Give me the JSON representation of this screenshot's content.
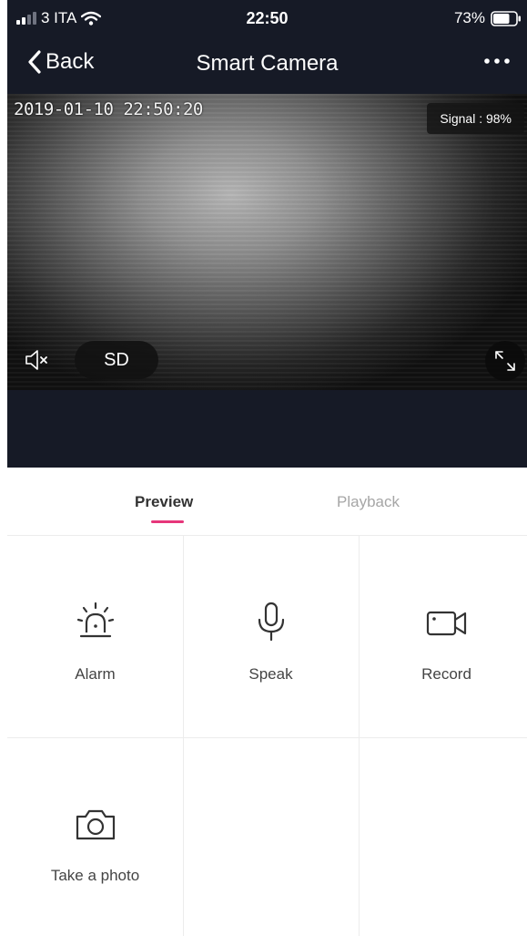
{
  "status_bar": {
    "carrier": "3 ITA",
    "time": "22:50",
    "battery": "73%",
    "battery_level": 0.73
  },
  "nav": {
    "back_label": "Back",
    "title": "Smart  Camera",
    "more_icon": "more-dots-icon"
  },
  "video": {
    "timestamp": "2019-01-10  22:50:20",
    "signal": "Signal : 98%",
    "quality": "SD",
    "mute_icon": "speaker-muted-icon",
    "fullscreen_icon": "fullscreen-icon"
  },
  "tabs": [
    {
      "label": "Preview",
      "active": true
    },
    {
      "label": "Playback",
      "active": false
    }
  ],
  "actions": [
    {
      "label": "Alarm",
      "icon": "alarm-siren-icon"
    },
    {
      "label": "Speak",
      "icon": "microphone-icon"
    },
    {
      "label": "Record",
      "icon": "video-camera-icon"
    },
    {
      "label": "Take a photo",
      "icon": "camera-icon"
    }
  ],
  "colors": {
    "header_bg": "#161a26",
    "accent": "#e6367a",
    "tab_inactive": "#a6a6a6"
  }
}
